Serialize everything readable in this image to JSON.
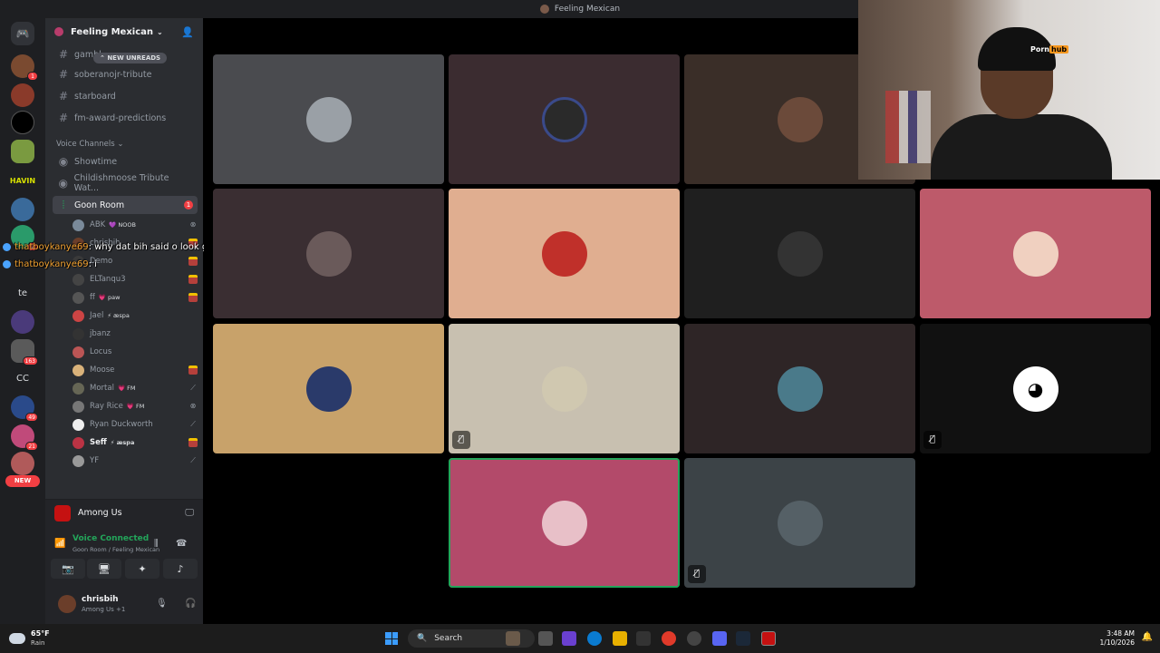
{
  "window": {
    "title": "Feeling Mexican"
  },
  "guilds": {
    "badges": [
      "1",
      "2",
      "163",
      "49",
      "21"
    ],
    "text_icons": [
      "te",
      "CC",
      "HAVIN"
    ],
    "new_label": "NEW"
  },
  "server": {
    "name": "Feeling Mexican",
    "new_unreads": "NEW UNREADS"
  },
  "text_channels": [
    "gambl...",
    "soberanojr-tribute",
    "starboard",
    "fm-award-predictions"
  ],
  "voice_category": "Voice Channels",
  "voice_channels": [
    {
      "name": "Showtime"
    },
    {
      "name": "Childishmoose Tribute Wat..."
    },
    {
      "name": "Goon Room",
      "badge": "1"
    }
  ],
  "voice_users": [
    {
      "name": "ABK",
      "tag": "💜 NOOB",
      "color": "#7a8a9a"
    },
    {
      "name": "chrisbih",
      "tag": "",
      "color": "#6b3e2a"
    },
    {
      "name": "Demo",
      "tag": "",
      "color": "#3a3a3a"
    },
    {
      "name": "ELTanqu3",
      "tag": "",
      "color": "#444"
    },
    {
      "name": "ff",
      "tag": "💗 paw",
      "color": "#555"
    },
    {
      "name": "Jael",
      "tag": "⚡ æspa",
      "color": "#c44"
    },
    {
      "name": "jbanz",
      "tag": "",
      "color": "#333"
    },
    {
      "name": "Locus",
      "tag": "",
      "color": "#b55"
    },
    {
      "name": "Moose",
      "tag": "",
      "color": "#d9b27a"
    },
    {
      "name": "Mortal",
      "tag": "💗 FM",
      "color": "#665"
    },
    {
      "name": "Ray Rice",
      "tag": "💗 FM",
      "color": "#777"
    },
    {
      "name": "Ryan Duckworth",
      "tag": "",
      "color": "#eee"
    },
    {
      "name": "Seff",
      "tag": "⚡ æspa",
      "color": "#b34"
    },
    {
      "name": "YF",
      "tag": "",
      "color": "#999"
    }
  ],
  "chat_overlay": [
    {
      "user": "thatboykanye69",
      "text": ": why dat bih said o look gay?"
    },
    {
      "user": "thatboykanye69",
      "text": ": i"
    }
  ],
  "activity": {
    "game": "Among Us"
  },
  "voice_status": {
    "status": "Voice Connected",
    "location": "Goon Room / Feeling Mexican"
  },
  "user_panel": {
    "name": "chrisbih",
    "status": "Among Us +1"
  },
  "taskbar": {
    "temp": "65°F",
    "condition": "Rain",
    "search_placeholder": "Search",
    "time": "3:48 AM",
    "date": "1/10/2026"
  },
  "webcam": {
    "logo_left": "Porn",
    "logo_right": "hub"
  }
}
